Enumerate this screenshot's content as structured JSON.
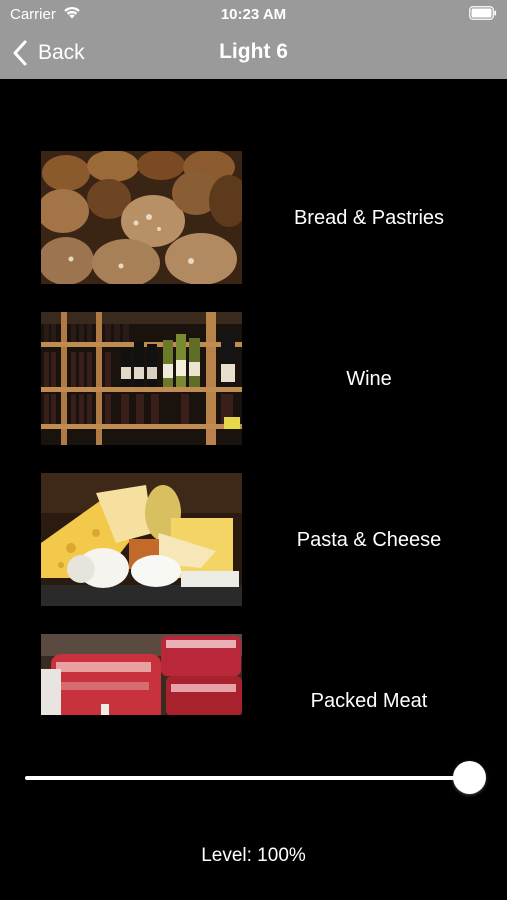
{
  "status_bar": {
    "carrier": "Carrier",
    "time": "10:23 AM",
    "icons": [
      "wifi-icon",
      "battery-icon"
    ]
  },
  "nav": {
    "back_label": "Back",
    "title": "Light 6"
  },
  "items": [
    {
      "label": "Bread & Pastries",
      "image": "bread-image"
    },
    {
      "label": "Wine",
      "image": "wine-image"
    },
    {
      "label": "Pasta & Cheese",
      "image": "cheese-image"
    },
    {
      "label": "Packed Meat",
      "image": "meat-image"
    }
  ],
  "slider": {
    "value": 1.0
  },
  "level_text": "Level: 100%",
  "colors": {
    "nav_background": "#9a9a9a",
    "background": "#000000",
    "text": "#ffffff"
  }
}
